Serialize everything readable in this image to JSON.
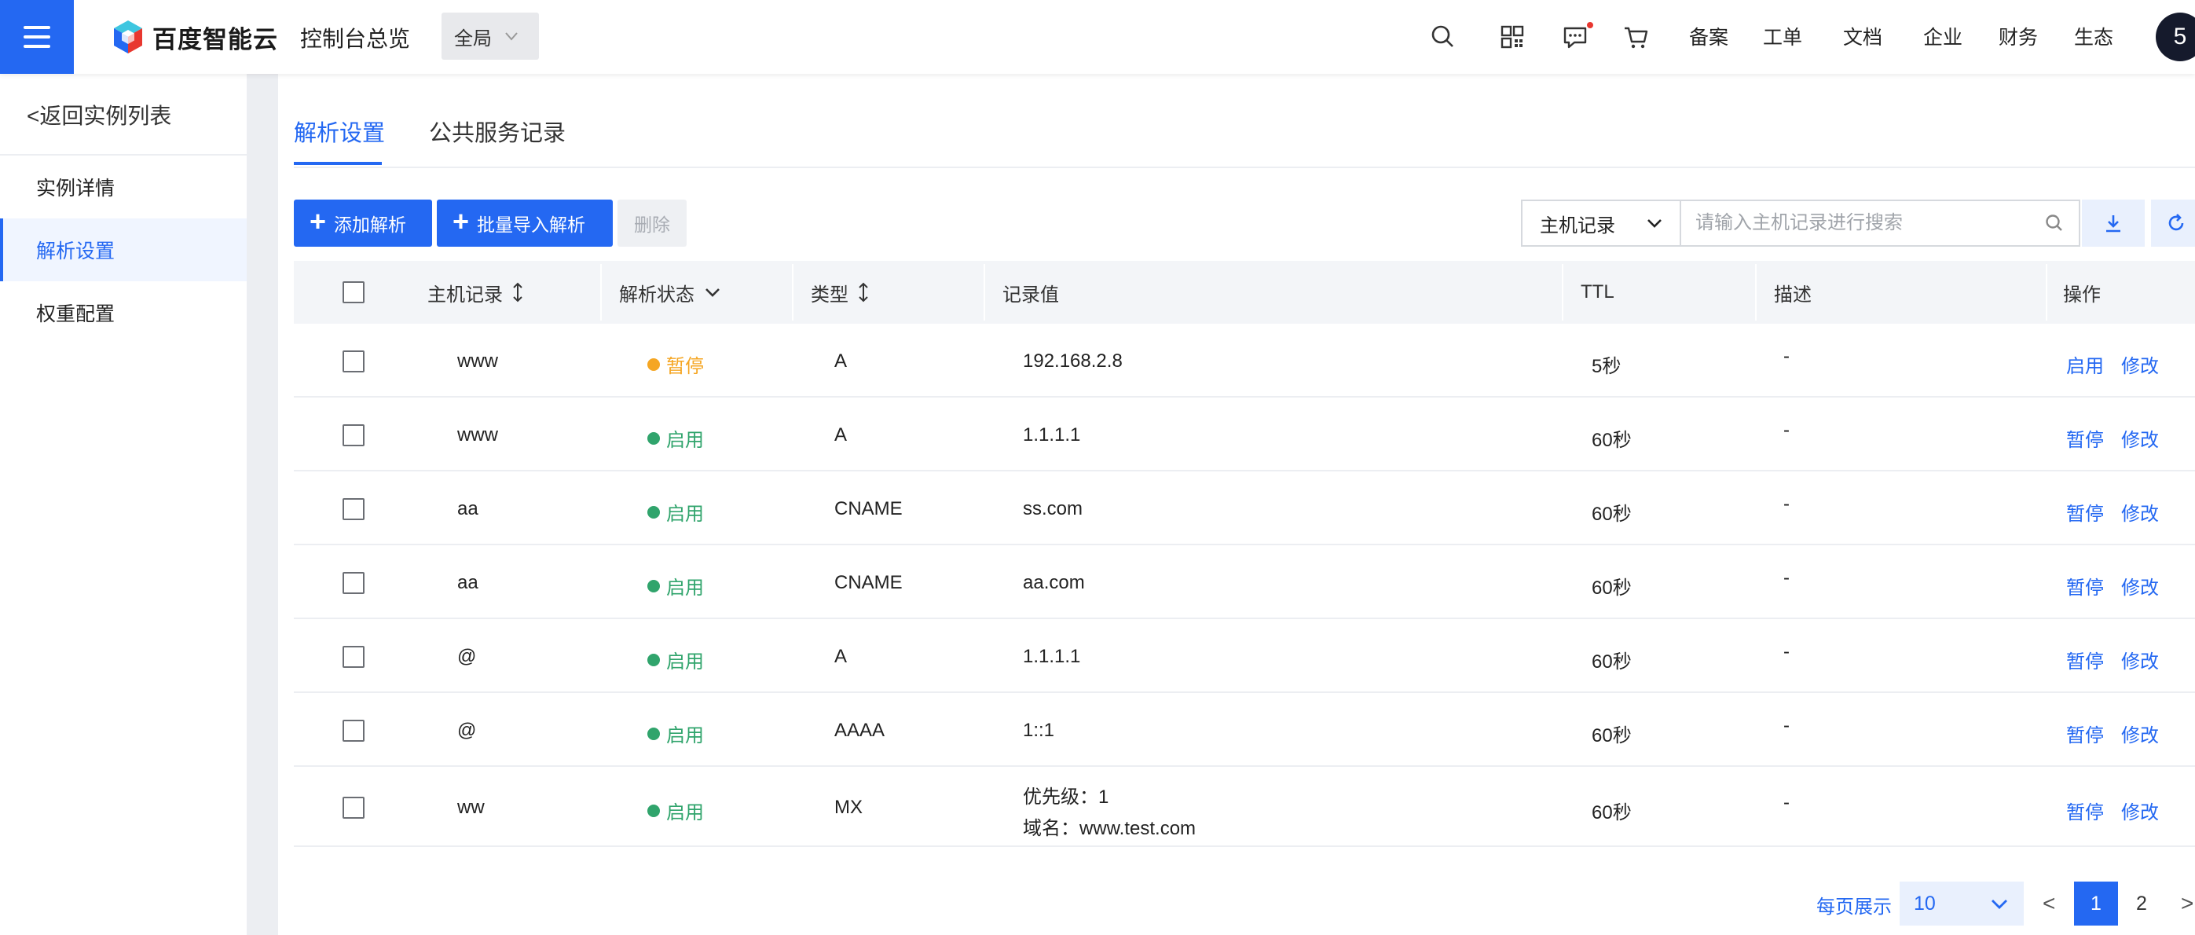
{
  "header": {
    "logo_text": "百度智能云",
    "console_title": "控制台总览",
    "region": "全局",
    "icons": [
      "search-icon",
      "qrcode-icon",
      "message-icon",
      "cart-icon"
    ],
    "nav": [
      "备案",
      "工单",
      "文档",
      "企业",
      "财务",
      "生态"
    ],
    "avatar": "5",
    "colors": {
      "brand": "#2468f2",
      "notification": "#e8372f"
    }
  },
  "sidebar": {
    "back": "<返回实例列表",
    "items": [
      "实例详情",
      "解析设置",
      "权重配置"
    ],
    "active": "解析设置"
  },
  "tabs": [
    "解析设置",
    "公共服务记录"
  ],
  "toolbar": {
    "add": "添加解析",
    "batch_import": "批量导入解析",
    "delete": "删除",
    "search_field": "主机记录",
    "search_placeholder": "请输入主机记录进行搜索",
    "icons": [
      "download-icon",
      "refresh-icon"
    ]
  },
  "table": {
    "headers": [
      "主机记录",
      "解析状态",
      "类型",
      "记录值",
      "TTL",
      "描述",
      "操作"
    ],
    "rows": [
      {
        "host": "www",
        "status": "暂停",
        "status_type": "pause",
        "type": "A",
        "value": "192.168.2.8",
        "value2": "",
        "ttl": "5秒",
        "desc": "-",
        "op1": "启用",
        "op2": "修改"
      },
      {
        "host": "www",
        "status": "启用",
        "status_type": "on",
        "type": "A",
        "value": "1.1.1.1",
        "value2": "",
        "ttl": "60秒",
        "desc": "-",
        "op1": "暂停",
        "op2": "修改"
      },
      {
        "host": "aa",
        "status": "启用",
        "status_type": "on",
        "type": "CNAME",
        "value": "ss.com",
        "value2": "",
        "ttl": "60秒",
        "desc": "-",
        "op1": "暂停",
        "op2": "修改"
      },
      {
        "host": "aa",
        "status": "启用",
        "status_type": "on",
        "type": "CNAME",
        "value": "aa.com",
        "value2": "",
        "ttl": "60秒",
        "desc": "-",
        "op1": "暂停",
        "op2": "修改"
      },
      {
        "host": "@",
        "status": "启用",
        "status_type": "on",
        "type": "A",
        "value": "1.1.1.1",
        "value2": "",
        "ttl": "60秒",
        "desc": "-",
        "op1": "暂停",
        "op2": "修改"
      },
      {
        "host": "@",
        "status": "启用",
        "status_type": "on",
        "type": "AAAA",
        "value": "1::1",
        "value2": "",
        "ttl": "60秒",
        "desc": "-",
        "op1": "暂停",
        "op2": "修改"
      },
      {
        "host": "ww",
        "status": "启用",
        "status_type": "on",
        "type": "MX",
        "value": "优先级：1",
        "value2": "域名：www.test.com",
        "ttl": "60秒",
        "desc": "-",
        "op1": "暂停",
        "op2": "修改"
      }
    ],
    "status_colors": {
      "on": "#30a46c",
      "pause": "#f5a623"
    }
  },
  "pagination": {
    "label": "每页展示",
    "page_size": "10",
    "prev": "<",
    "pages": [
      "1",
      "2"
    ],
    "current": "1",
    "next": ">"
  }
}
